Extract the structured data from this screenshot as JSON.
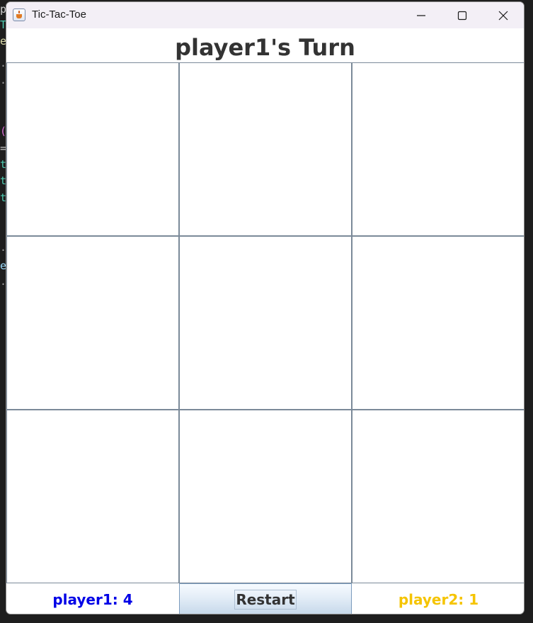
{
  "window": {
    "title": "Tic-Tac-Toe"
  },
  "window_controls": {
    "minimize_icon": "minimize-icon",
    "maximize_icon": "maximize-icon",
    "close_icon": "close-icon"
  },
  "status": {
    "turn_text": "player1's Turn"
  },
  "board": {
    "cells": [
      "",
      "",
      "",
      "",
      "",
      "",
      "",
      "",
      ""
    ]
  },
  "footer": {
    "player1_score": "player1: 4",
    "restart_label": "Restart",
    "player2_score": "player2: 1"
  },
  "colors": {
    "player1": "#0000e6",
    "player2": "#f5c400",
    "heading": "#333333",
    "grid_line": "#7b8a99"
  },
  "background_fragments": [
    "p",
    "T",
    "e",
    "·",
    "·",
    "(",
    "=",
    "t",
    "t",
    "t",
    ".",
    "e",
    "·"
  ]
}
